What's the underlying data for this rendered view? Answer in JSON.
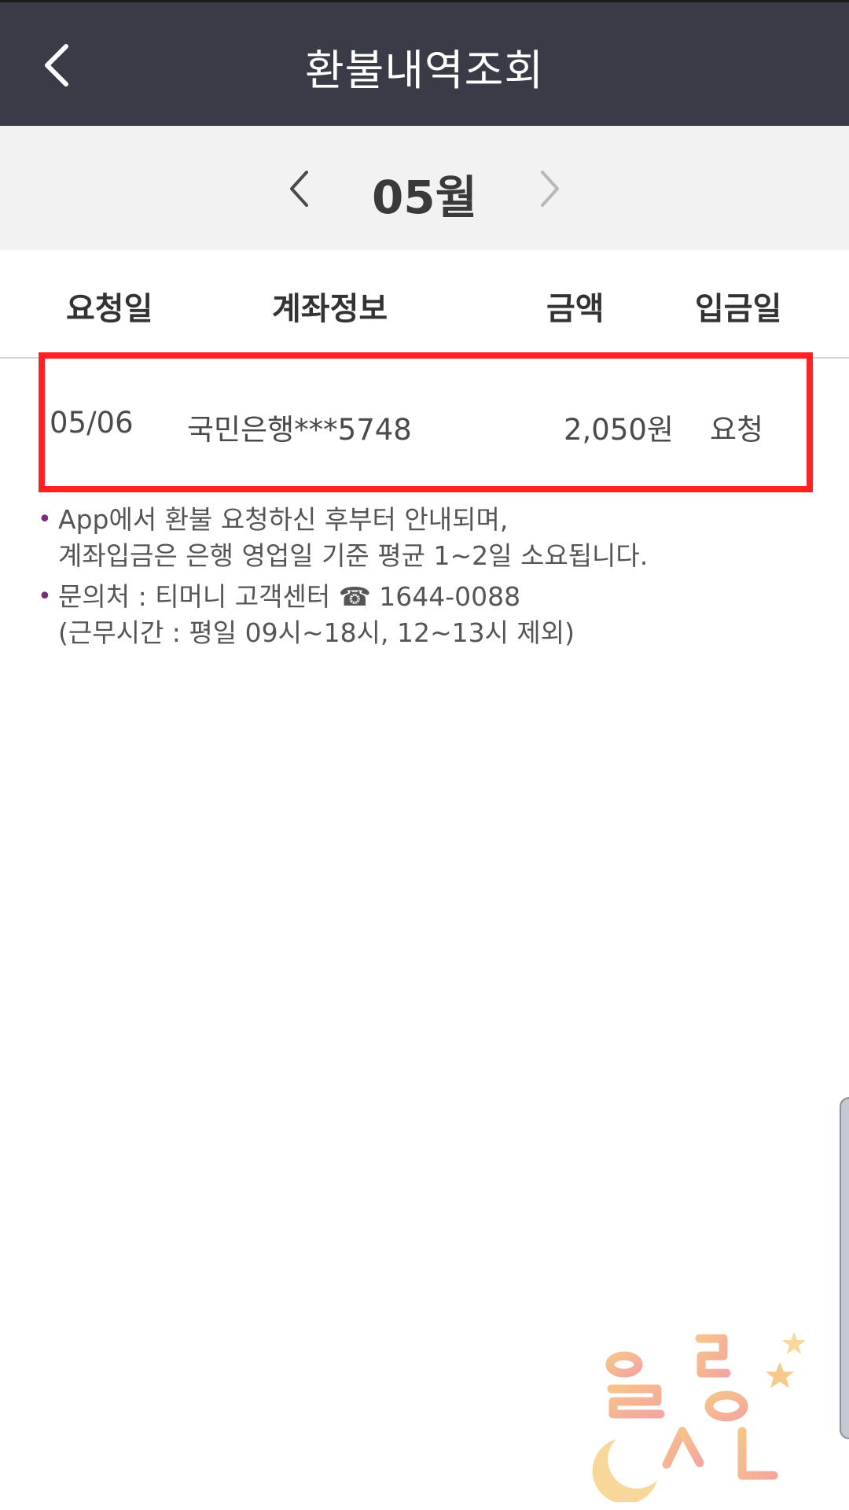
{
  "appbar": {
    "title": "환불내역조회",
    "back_icon": "chevron-left-icon",
    "background": "#393c46"
  },
  "month_nav": {
    "label": "05월",
    "prev_icon": "chevron-left-icon",
    "next_icon": "chevron-right-icon"
  },
  "table": {
    "headers": {
      "request_date": "요청일",
      "account_info": "계좌정보",
      "amount": "금액",
      "deposit_date": "입금일"
    },
    "rows": [
      {
        "request_date": "05/06",
        "account_info": "국민은행***5748",
        "amount": "2,050원",
        "deposit_date": "요청"
      }
    ],
    "highlight_color": "#ff2222"
  },
  "notes": [
    {
      "line1": "App에서 환불 요청하신 후부터 안내되며,",
      "line2": "계좌입금은 은행 영업일 기준 평균 1~2일 소요됩니다."
    },
    {
      "line1": "문의처 : 티머니 고객센터 ☎ 1644-0088",
      "line2": "(근무시간 : 평일 09시~18시, 12~13시 제외)"
    }
  ],
  "watermark": {
    "text": "힐링소녀"
  }
}
